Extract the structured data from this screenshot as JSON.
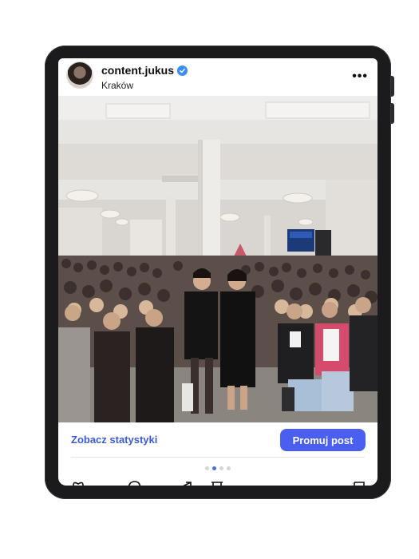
{
  "post": {
    "username": "content.jukus",
    "location": "Kraków",
    "more_icon": "more-horizontal-icon",
    "verified_icon": "verified-badge-icon",
    "avatar_icon": "profile-avatar"
  },
  "actions": {
    "stats_label": "Zobacz statystyki",
    "promote_label": "Promuj post"
  },
  "carousel": {
    "count": 4,
    "active_index": 1
  },
  "bottom_icons": [
    "heart-icon",
    "comment-icon",
    "share-icon",
    "bookmark-icon"
  ],
  "colors": {
    "accent": "#4a5ff0",
    "link": "#3a5bd9",
    "verified": "#3a8cf6"
  }
}
